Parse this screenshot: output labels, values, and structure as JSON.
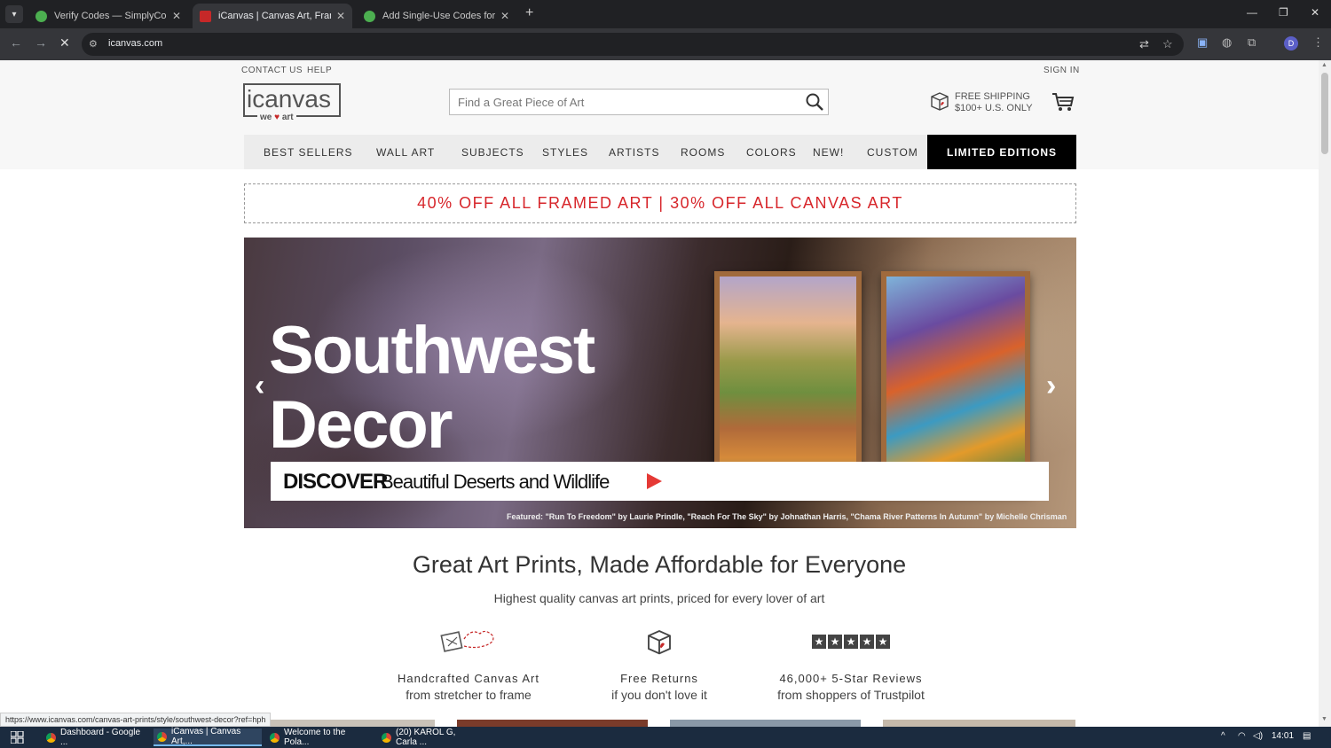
{
  "browser": {
    "tabs": [
      {
        "title": "Verify Codes — SimplyCodes",
        "active": false
      },
      {
        "title": "iCanvas | Canvas Art, Framed C",
        "active": true
      },
      {
        "title": "Add Single-Use Codes for Polar",
        "active": false
      }
    ],
    "url": "icanvas.com",
    "status_url": "https://www.icanvas.com/canvas-art-prints/style/southwest-decor?ref=hph"
  },
  "site": {
    "util_links": {
      "contact": "CONTACT US",
      "help": "HELP",
      "sign_in": "SIGN IN"
    },
    "logo": {
      "word": "icanvas",
      "tag_we": "we",
      "tag_art": "art"
    },
    "search": {
      "placeholder": "Find a Great Piece of Art"
    },
    "shipping": {
      "line1": "FREE SHIPPING",
      "line2": "$100+ U.S. ONLY"
    },
    "nav": [
      "BEST SELLERS",
      "WALL ART",
      "SUBJECTS",
      "STYLES",
      "ARTISTS",
      "ROOMS",
      "COLORS",
      "NEW!",
      "CUSTOM"
    ],
    "nav_highlight": "LIMITED EDITIONS",
    "promo": "40% OFF ALL FRAMED ART | 30% OFF ALL CANVAS ART",
    "promo_color": "#d7262b",
    "hero": {
      "title_line1": "Southwest",
      "title_line2": "Decor",
      "cta_bold": "DISCOVER",
      "cta_rest": "Beautiful Deserts and Wildlife",
      "caption": "Featured: \"Run To Freedom\" by Laurie Prindle, \"Reach For The Sky\" by Johnathan Harris, \"Chama River Patterns In Autumn\" by Michelle Chrisman"
    },
    "section": {
      "title": "Great Art Prints, Made Affordable for Everyone",
      "subtitle": "Highest quality canvas art prints, priced for every lover of art"
    },
    "features": [
      {
        "icon": "handcrafted-icon",
        "heading": "Handcrafted Canvas Art",
        "sub": "from stretcher to frame"
      },
      {
        "icon": "returns-box-icon",
        "heading": "Free Returns",
        "sub": "if you don't love it"
      },
      {
        "icon": "five-stars-icon",
        "heading": "46,000+ 5-Star Reviews",
        "sub": "from shoppers of Trustpilot"
      }
    ]
  },
  "taskbar": {
    "items": [
      {
        "label": "Dashboard - Google ...",
        "active": false
      },
      {
        "label": "iCanvas | Canvas Art,...",
        "active": true
      },
      {
        "label": "Welcome to the Pola...",
        "active": false
      },
      {
        "label": "(20) KAROL G, Carla ...",
        "active": false
      }
    ],
    "clock": "14:01"
  }
}
